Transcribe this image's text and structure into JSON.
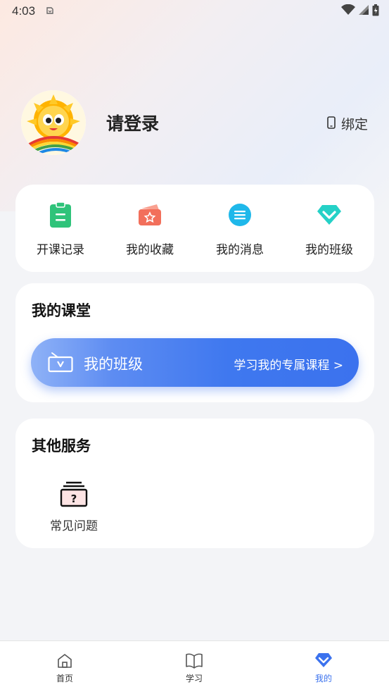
{
  "status": {
    "time": "4:03"
  },
  "profile": {
    "login_text": "请登录",
    "bind_label": "绑定"
  },
  "quick_actions": [
    {
      "label": "开课记录",
      "icon": "clipboard-icon",
      "color": "#2fc37a"
    },
    {
      "label": "我的收藏",
      "icon": "favorite-star-icon",
      "color": "#f26f5b"
    },
    {
      "label": "我的消息",
      "icon": "message-icon",
      "color": "#1fb8ea"
    },
    {
      "label": "我的班级",
      "icon": "diamond-icon",
      "color": "#25d1c7"
    }
  ],
  "classroom": {
    "title": "我的课堂",
    "banner_title": "我的班级",
    "banner_sub": "学习我的专属课程 >"
  },
  "services": {
    "title": "其他服务",
    "items": [
      {
        "label": "常见问题",
        "icon": "faq-icon"
      }
    ]
  },
  "tabbar": [
    {
      "label": "首页",
      "icon": "home-icon",
      "active": false
    },
    {
      "label": "学习",
      "icon": "book-icon",
      "active": false
    },
    {
      "label": "我的",
      "icon": "diamond-icon",
      "active": true
    }
  ],
  "colors": {
    "accent": "#3b72ee"
  }
}
